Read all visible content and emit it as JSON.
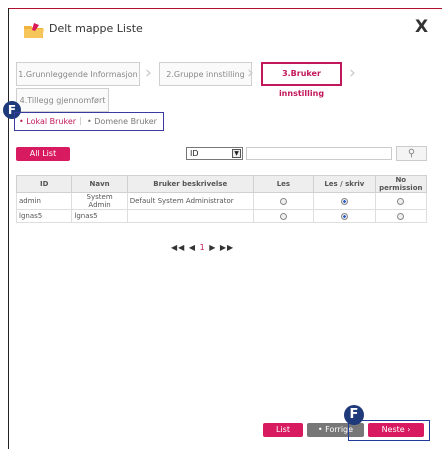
{
  "dialog": {
    "title": "Delt mappe Liste",
    "close_label": "X"
  },
  "steps": [
    {
      "label": "1.Grunnleggende Informasjon"
    },
    {
      "label": "2.Gruppe innstilling"
    },
    {
      "label": "3.Bruker innstilling"
    },
    {
      "label": "4.Tillegg gjennomført"
    }
  ],
  "badges": {
    "a": "F",
    "b": "F"
  },
  "tabs": {
    "local": "• Lokal Bruker",
    "separator": "|",
    "domain": "• Domene Bruker"
  },
  "toolbar": {
    "all_list": "All List",
    "select_value": "ID",
    "search_icon": "search-icon"
  },
  "table": {
    "headers": [
      "ID",
      "Navn",
      "Bruker beskrivelse",
      "Les",
      "Les / skriv",
      "No permission"
    ],
    "rows": [
      {
        "id": "admin",
        "name": "System Admin",
        "desc": "Default System Administrator",
        "selected": "Les / skriv"
      },
      {
        "id": "lgnas5",
        "name": "lgnas5",
        "desc": "",
        "selected": "Les / skriv"
      }
    ]
  },
  "pager": {
    "first": "◀◀",
    "prev": "◀",
    "page": "1",
    "next": "▶",
    "last": "▶▶"
  },
  "footer": {
    "list": "List",
    "prev": "• Forrige",
    "next": "Neste ›"
  },
  "colors": {
    "accent": "#d81b60",
    "highlight_border": "#1f3a9a",
    "badge": "#1f3a7a"
  }
}
